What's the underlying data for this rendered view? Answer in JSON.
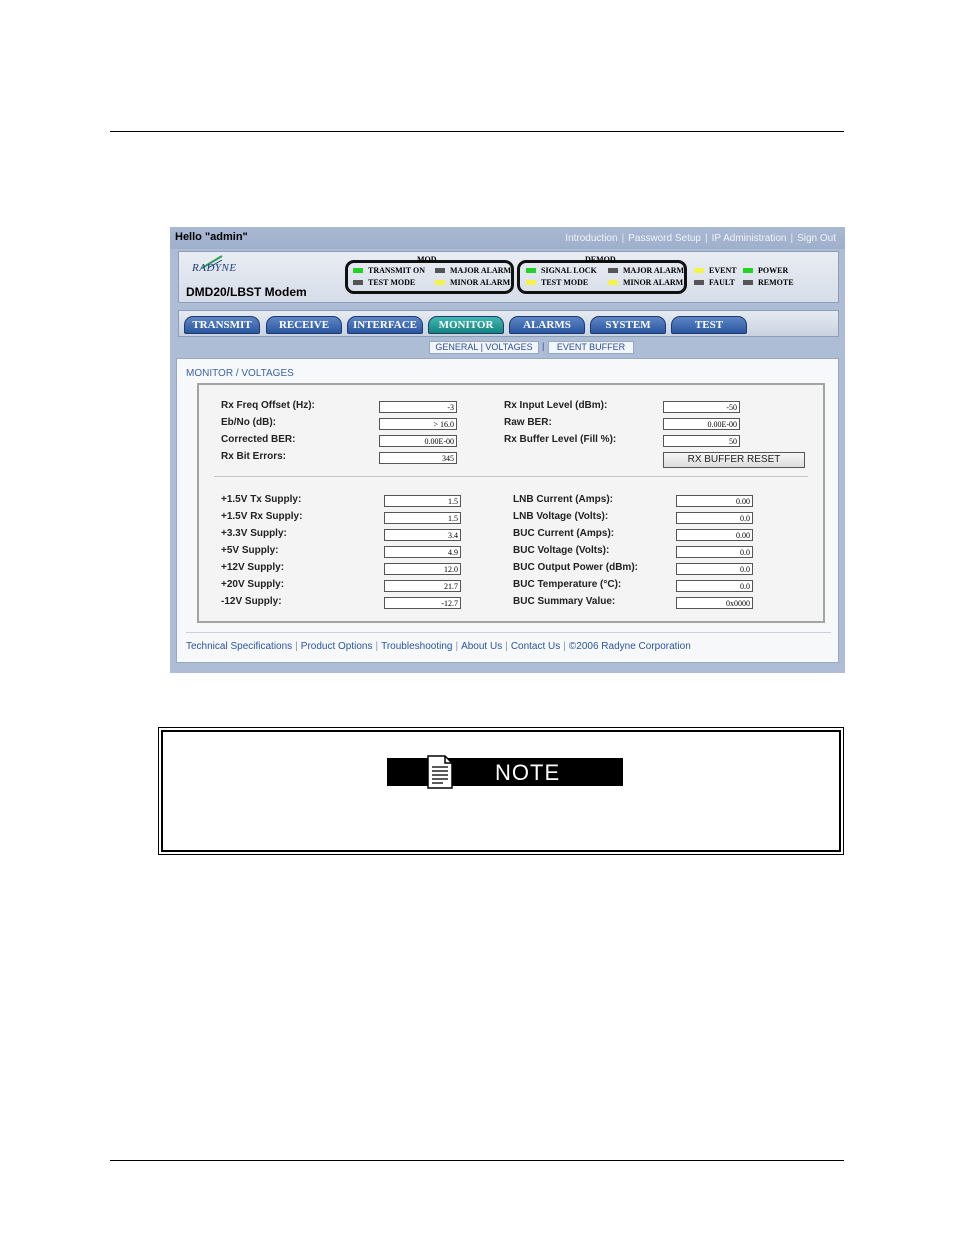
{
  "header_bar": {
    "greeting": "Hello \"admin\"",
    "links": [
      "Introduction",
      "Password Setup",
      "IP Administration",
      "Sign Out"
    ]
  },
  "device": {
    "brand": "RADYNE",
    "model": "DMD20/LBST Modem"
  },
  "status": {
    "mod_title": "MOD",
    "demod_title": "DEMOD",
    "leds": {
      "transmit_on": "TRANSMIT ON",
      "mod_major_alarm": "MAJOR ALARM",
      "mod_test_mode": "TEST MODE",
      "mod_minor_alarm": "MINOR ALARM",
      "signal_lock": "SIGNAL LOCK",
      "demod_major_alarm": "MAJOR ALARM",
      "demod_test_mode": "TEST MODE",
      "demod_minor_alarm": "MINOR ALARM",
      "event": "EVENT",
      "power": "POWER",
      "fault": "FAULT",
      "remote": "REMOTE"
    },
    "colors": {
      "green": "#22d422",
      "yellow": "#f3f34a",
      "off": "#555555"
    }
  },
  "tabs": [
    "TRANSMIT",
    "RECEIVE",
    "INTERFACE",
    "MONITOR",
    "ALARMS",
    "SYSTEM",
    "TEST"
  ],
  "active_tab": "MONITOR",
  "subnav": {
    "general_voltages": "GENERAL | VOLTAGES",
    "sep": "|",
    "event_buffer": "EVENT BUFFER"
  },
  "breadcrumb": "MONITOR / VOLTAGES",
  "rx": {
    "freq_offset_label": "Rx Freq Offset (Hz):",
    "freq_offset": "-3",
    "ebno_label": "Eb/No (dB):",
    "ebno": "> 16.0",
    "corrected_ber_label": "Corrected BER:",
    "corrected_ber": "0.00E-00",
    "bit_errors_label": "Rx Bit Errors:",
    "bit_errors": "345",
    "input_level_label": "Rx Input Level (dBm):",
    "input_level": "-50",
    "raw_ber_label": "Raw BER:",
    "raw_ber": "0.00E-00",
    "buffer_level_label": "Rx Buffer Level (Fill %):",
    "buffer_level": "50",
    "buffer_reset": "RX BUFFER RESET"
  },
  "supplies": {
    "tx15_label": "+1.5V Tx Supply:",
    "tx15": "1.5",
    "rx15_label": "+1.5V Rx Supply:",
    "rx15": "1.5",
    "v33_label": "+3.3V Supply:",
    "v33": "3.4",
    "v5_label": "+5V Supply:",
    "v5": "4.9",
    "v12_label": "+12V Supply:",
    "v12": "12.0",
    "v20_label": "+20V Supply:",
    "v20": "21.7",
    "vm12_label": "-12V Supply:",
    "vm12": "-12.7"
  },
  "lnb_buc": {
    "lnb_current_label": "LNB Current (Amps):",
    "lnb_current": "0.00",
    "lnb_voltage_label": "LNB Voltage (Volts):",
    "lnb_voltage": "0.0",
    "buc_current_label": "BUC Current (Amps):",
    "buc_current": "0.00",
    "buc_voltage_label": "BUC Voltage (Volts):",
    "buc_voltage": "0.0",
    "buc_output_power_label": "BUC Output Power (dBm):",
    "buc_output_power": "0.0",
    "buc_temperature_label": "BUC Temperature (°C):",
    "buc_temperature": "0.0",
    "buc_summary_label": "BUC Summary Value:",
    "buc_summary": "0x0000"
  },
  "footer": {
    "links": [
      "Technical Specifications",
      "Product Options",
      "Troubleshooting",
      "About Us",
      "Contact Us"
    ],
    "copyright": "©2006 Radyne Corporation"
  },
  "note": {
    "label": "NOTE"
  }
}
